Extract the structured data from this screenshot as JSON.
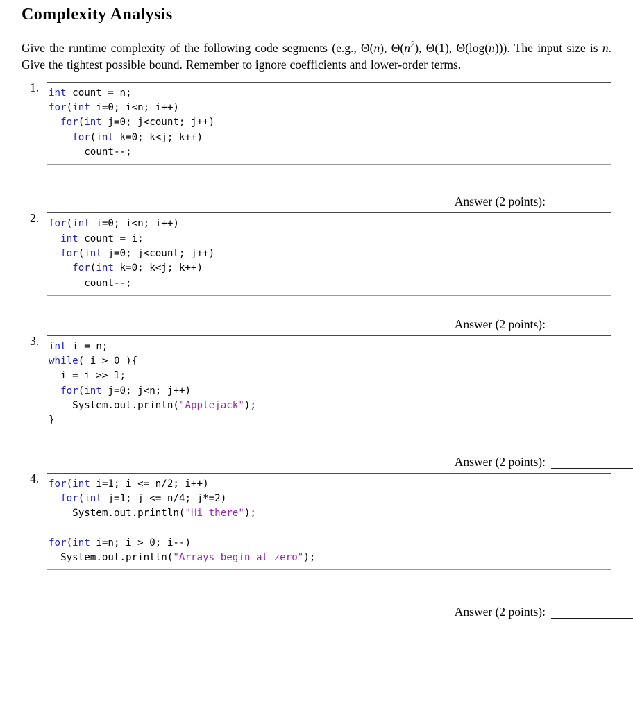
{
  "document": {
    "title": "Complexity Analysis",
    "intro": {
      "part1": "Give the runtime complexity of the following code segments (e.g., ",
      "theta1_open": "Θ(",
      "theta1_var": "n",
      "theta1_close": "), ",
      "theta2_open": "Θ(",
      "theta2_var": "n",
      "theta2_sup": "2",
      "theta2_close": "), ",
      "theta3": "Θ(1), ",
      "theta4_open": "Θ(log(",
      "theta4_var": "n",
      "theta4_close": "))).",
      "part2_a": " The input size is ",
      "part2_var": "n",
      "part2_b": ". Give the tightest possible bound. Remember to ignore coefficients and lower-order terms."
    },
    "answer_label": "Answer (2 points):"
  },
  "questions": [
    {
      "number": "1.",
      "code_lines": [
        [
          {
            "t": "int",
            "c": "kw"
          },
          {
            "t": " count = n;",
            "c": ""
          }
        ],
        [
          {
            "t": "for",
            "c": "kw"
          },
          {
            "t": "(",
            "c": ""
          },
          {
            "t": "int",
            "c": "kw"
          },
          {
            "t": " i=0; i<n; i++)",
            "c": ""
          }
        ],
        [
          {
            "t": "  ",
            "c": ""
          },
          {
            "t": "for",
            "c": "kw"
          },
          {
            "t": "(",
            "c": ""
          },
          {
            "t": "int",
            "c": "kw"
          },
          {
            "t": " j=0; j<count; j++)",
            "c": ""
          }
        ],
        [
          {
            "t": "    ",
            "c": ""
          },
          {
            "t": "for",
            "c": "kw"
          },
          {
            "t": "(",
            "c": ""
          },
          {
            "t": "int",
            "c": "kw"
          },
          {
            "t": " k=0; k<j; k++)",
            "c": ""
          }
        ],
        [
          {
            "t": "      count--;",
            "c": ""
          }
        ]
      ]
    },
    {
      "number": "2.",
      "code_lines": [
        [
          {
            "t": "for",
            "c": "kw"
          },
          {
            "t": "(",
            "c": ""
          },
          {
            "t": "int",
            "c": "kw"
          },
          {
            "t": " i=0; i<n; i++)",
            "c": ""
          }
        ],
        [
          {
            "t": "  ",
            "c": ""
          },
          {
            "t": "int",
            "c": "kw"
          },
          {
            "t": " count = i;",
            "c": ""
          }
        ],
        [
          {
            "t": "  ",
            "c": ""
          },
          {
            "t": "for",
            "c": "kw"
          },
          {
            "t": "(",
            "c": ""
          },
          {
            "t": "int",
            "c": "kw"
          },
          {
            "t": " j=0; j<count; j++)",
            "c": ""
          }
        ],
        [
          {
            "t": "    ",
            "c": ""
          },
          {
            "t": "for",
            "c": "kw"
          },
          {
            "t": "(",
            "c": ""
          },
          {
            "t": "int",
            "c": "kw"
          },
          {
            "t": " k=0; k<j; k++)",
            "c": ""
          }
        ],
        [
          {
            "t": "      count--;",
            "c": ""
          }
        ]
      ]
    },
    {
      "number": "3.",
      "code_lines": [
        [
          {
            "t": "int",
            "c": "kw"
          },
          {
            "t": " i = n;",
            "c": ""
          }
        ],
        [
          {
            "t": "while",
            "c": "kw"
          },
          {
            "t": "( i > 0 ){",
            "c": ""
          }
        ],
        [
          {
            "t": "  i = i >> 1;",
            "c": ""
          }
        ],
        [
          {
            "t": "  ",
            "c": ""
          },
          {
            "t": "for",
            "c": "kw"
          },
          {
            "t": "(",
            "c": ""
          },
          {
            "t": "int",
            "c": "kw"
          },
          {
            "t": " j=0; j<n; j++)",
            "c": ""
          }
        ],
        [
          {
            "t": "    System.out.prinln(",
            "c": ""
          },
          {
            "t": "\"Applejack\"",
            "c": "str"
          },
          {
            "t": ");",
            "c": ""
          }
        ],
        [
          {
            "t": "}",
            "c": ""
          }
        ]
      ]
    },
    {
      "number": "4.",
      "code_lines": [
        [
          {
            "t": "for",
            "c": "kw"
          },
          {
            "t": "(",
            "c": ""
          },
          {
            "t": "int",
            "c": "kw"
          },
          {
            "t": " i=1; i <= n/2; i++)",
            "c": ""
          }
        ],
        [
          {
            "t": "  ",
            "c": ""
          },
          {
            "t": "for",
            "c": "kw"
          },
          {
            "t": "(",
            "c": ""
          },
          {
            "t": "int",
            "c": "kw"
          },
          {
            "t": " j=1; j <= n/4; j*=2)",
            "c": ""
          }
        ],
        [
          {
            "t": "    System.out.println(",
            "c": ""
          },
          {
            "t": "\"Hi there\"",
            "c": "str"
          },
          {
            "t": ");",
            "c": ""
          }
        ],
        [
          {
            "t": "",
            "c": ""
          }
        ],
        [
          {
            "t": "for",
            "c": "kw"
          },
          {
            "t": "(",
            "c": ""
          },
          {
            "t": "int",
            "c": "kw"
          },
          {
            "t": " i=n; i > 0; i--)",
            "c": ""
          }
        ],
        [
          {
            "t": "  System.out.println(",
            "c": ""
          },
          {
            "t": "\"Arrays begin at zero\"",
            "c": "str"
          },
          {
            "t": ");",
            "c": ""
          }
        ]
      ]
    }
  ],
  "colors": {
    "keyword": "#2020d0",
    "string": "#a020c0",
    "rule_top": "#4a4a4a",
    "rule_bottom": "#9a9a9a",
    "text": "#000000"
  }
}
